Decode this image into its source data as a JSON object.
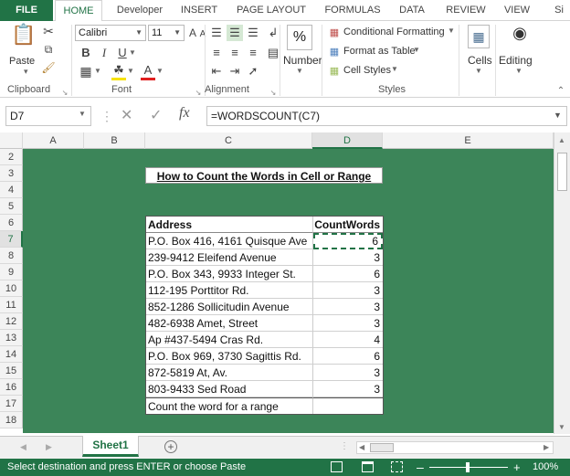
{
  "ribbon_tabs": [
    "FILE",
    "HOME",
    "Developer",
    "INSERT",
    "PAGE LAYOUT",
    "FORMULAS",
    "DATA",
    "REVIEW",
    "VIEW",
    "Si"
  ],
  "clipboard": {
    "paste": "Paste",
    "label": "Clipboard"
  },
  "font": {
    "name": "Calibri",
    "size": "11",
    "label": "Font"
  },
  "alignment": {
    "label": "Alignment"
  },
  "number": {
    "label": "Number",
    "percent": "%"
  },
  "styles": {
    "conditional": "Conditional Formatting",
    "table": "Format as Table",
    "cell": "Cell Styles",
    "label": "Styles"
  },
  "cells": {
    "label": "Cells"
  },
  "editing": {
    "label": "Editing"
  },
  "formula_bar": {
    "name_box": "D7",
    "fx": "fx",
    "formula": "=WORDSCOUNT(C7)"
  },
  "columns": [
    "A",
    "B",
    "C",
    "D",
    "E"
  ],
  "rows": [
    "2",
    "3",
    "4",
    "5",
    "6",
    "7",
    "8",
    "9",
    "10",
    "11",
    "12",
    "13",
    "14",
    "15",
    "16",
    "17",
    "18"
  ],
  "sheet": {
    "title": "How to Count the Words in Cell or Range",
    "header_address": "Address",
    "header_count": "CountWords",
    "data": [
      {
        "address": "P.O. Box 416, 4161 Quisque Ave",
        "count": "6"
      },
      {
        "address": "239-9412 Eleifend Avenue",
        "count": "3"
      },
      {
        "address": "P.O. Box 343, 9933 Integer St.",
        "count": "6"
      },
      {
        "address": "112-195 Porttitor Rd.",
        "count": "3"
      },
      {
        "address": "852-1286 Sollicitudin Avenue",
        "count": "3"
      },
      {
        "address": "482-6938 Amet, Street",
        "count": "3"
      },
      {
        "address": "Ap #437-5494 Cras Rd.",
        "count": "4"
      },
      {
        "address": "P.O. Box 969, 3730 Sagittis Rd.",
        "count": "6"
      },
      {
        "address": "872-5819 At, Av.",
        "count": "3"
      },
      {
        "address": "803-9433 Sed Road",
        "count": "3"
      }
    ],
    "footer": "Count the word for a range"
  },
  "sheet_tab": "Sheet1",
  "status": {
    "text": "Select destination and press ENTER or choose Paste",
    "zoom": "100%"
  },
  "colors": {
    "excel_green": "#217346",
    "fill_green": "#3c8559"
  }
}
